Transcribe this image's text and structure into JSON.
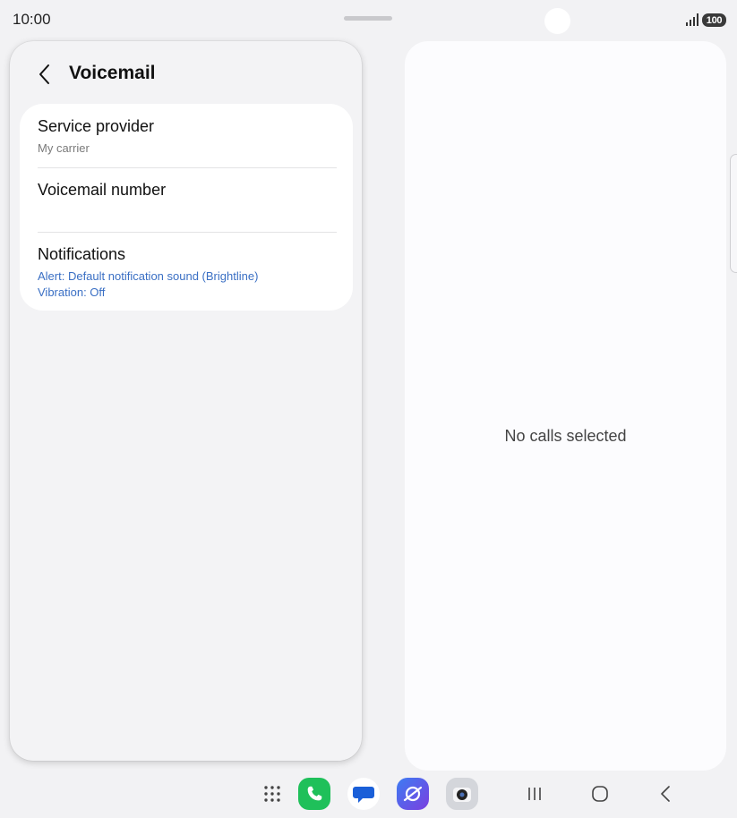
{
  "status_bar": {
    "time": "10:00",
    "battery": "100"
  },
  "header": {
    "title": "Voicemail",
    "back_icon": "chevron-left-icon"
  },
  "settings": [
    {
      "title": "Service provider",
      "subtitle": "My carrier"
    },
    {
      "title": "Voicemail number",
      "subtitle": ""
    },
    {
      "title": "Notifications",
      "lines": [
        "Alert: Default notification sound (Brightline)",
        "Vibration: Off"
      ]
    }
  ],
  "detail_pane": {
    "empty_text": "No calls selected"
  },
  "taskbar": {
    "apps": [
      {
        "name": "apps-grid-icon"
      },
      {
        "name": "phone-app-icon",
        "color": "#1fc05a"
      },
      {
        "name": "messages-app-icon",
        "color": "#1a5fd8"
      },
      {
        "name": "internet-app-icon",
        "color": "#5a4de0"
      },
      {
        "name": "camera-app-icon",
        "color": "#c9cbd1"
      }
    ],
    "nav": [
      {
        "name": "recents-icon"
      },
      {
        "name": "home-icon"
      },
      {
        "name": "back-nav-icon"
      }
    ]
  },
  "colors": {
    "background": "#f2f2f4",
    "link_blue": "#3a6fc4",
    "card": "#ffffff"
  }
}
